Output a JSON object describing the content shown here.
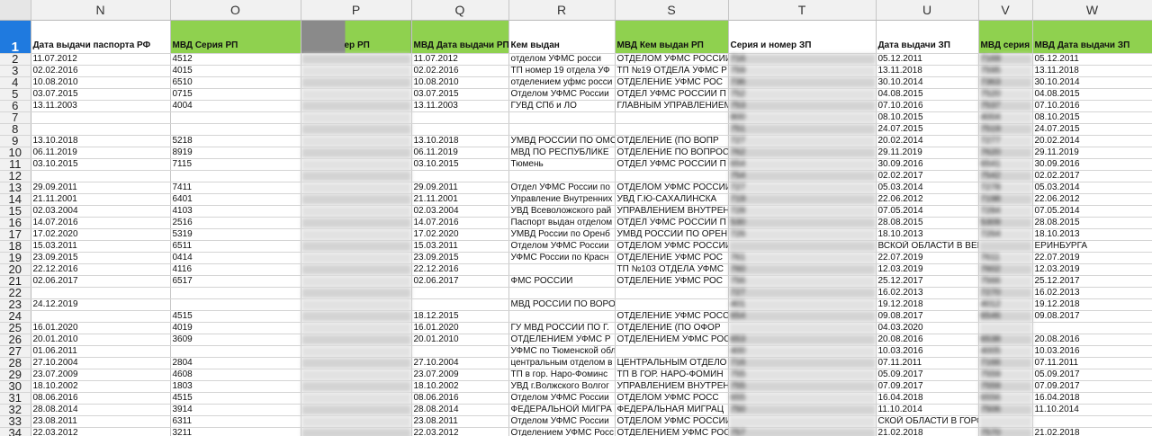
{
  "columns": [
    "N",
    "O",
    "P",
    "Q",
    "R",
    "S",
    "T",
    "U",
    "V",
    "W"
  ],
  "header_row": {
    "num": "1",
    "cells": [
      "Дата выдачи паспорта РФ",
      "МВД Серия РП",
      "ер РП",
      "МВД Дата выдачи РП",
      "Кем выдан",
      "МВД Кем выдан РП",
      "Серия и номер ЗП",
      "Дата выдачи ЗП",
      "МВД серия",
      "МВД Дата выдачи ЗП"
    ]
  },
  "rows": [
    {
      "num": "2",
      "cells": [
        "11.07.2012",
        "4512",
        "",
        "11.07.2012",
        "отделом УФМС росси",
        "ОТДЕЛОМ УФМС РОССИИ",
        "716",
        "05.12.2011",
        "7169",
        "05.12.2011"
      ]
    },
    {
      "num": "3",
      "cells": [
        "02.02.2016",
        "4015",
        "",
        "02.02.2016",
        "ТП номер 19 отдела УФ",
        "ТП №19 ОТДЕЛА УФМС Р",
        "759",
        "13.11.2018",
        "7595",
        "13.11.2018"
      ]
    },
    {
      "num": "4",
      "cells": [
        "10.08.2010",
        "6510",
        "",
        "10.08.2010",
        "отделением уфмс росси",
        "ОТДЕЛЕНИЕ УФМС РОС",
        "736",
        "30.10.2014",
        "7363",
        "30.10.2014"
      ]
    },
    {
      "num": "5",
      "cells": [
        "03.07.2015",
        "0715",
        "",
        "03.07.2015",
        "Отделом УФМС России",
        "ОТДЕЛ УФМС РОССИИ П",
        "752",
        "04.08.2015",
        "7520",
        "04.08.2015"
      ]
    },
    {
      "num": "6",
      "cells": [
        "13.11.2003",
        "4004",
        "",
        "13.11.2003",
        "ГУВД СПб и ЛО",
        "ГЛАВНЫМ УПРАВЛЕНИЕМ",
        "753",
        "07.10.2016",
        "7537",
        "07.10.2016"
      ]
    },
    {
      "num": "7",
      "cells": [
        "",
        "",
        "",
        "",
        "",
        "",
        "800",
        "08.10.2015",
        "4004",
        "08.10.2015"
      ]
    },
    {
      "num": "8",
      "cells": [
        "",
        "",
        "",
        "",
        "",
        "",
        "751",
        "24.07.2015",
        "7519",
        "24.07.2015"
      ]
    },
    {
      "num": "9",
      "cells": [
        "13.10.2018",
        "5218",
        "",
        "13.10.2018",
        "УМВД РОССИИ ПО ОМС",
        "ОТДЕЛЕНИЕ (ПО ВОПР",
        "727",
        "20.02.2014",
        "7277",
        "20.02.2014"
      ]
    },
    {
      "num": "10",
      "cells": [
        "06.11.2019",
        "8919",
        "",
        "06.11.2019",
        "МВД ПО РЕСПУБЛИКЕ",
        "ОТДЕЛЕНИЕ ПО ВОПРОС",
        "762",
        "29.11.2019",
        "7620",
        "29.11.2019"
      ]
    },
    {
      "num": "11",
      "cells": [
        "03.10.2015",
        "7115",
        "",
        "03.10.2015",
        "Тюмень",
        "ОТДЕЛ УФМС РОССИИ П",
        "654",
        "30.09.2016",
        "6541",
        "30.09.2016"
      ]
    },
    {
      "num": "12",
      "cells": [
        "",
        "",
        "",
        "",
        "",
        "",
        "754",
        "02.02.2017",
        "7542",
        "02.02.2017"
      ]
    },
    {
      "num": "13",
      "cells": [
        "29.09.2011",
        "7411",
        "",
        "29.09.2011",
        "Отдел УФМС России по",
        "ОТДЕЛОМ УФМС РОССИИ",
        "727",
        "05.03.2014",
        "7278",
        "05.03.2014"
      ]
    },
    {
      "num": "14",
      "cells": [
        "21.11.2001",
        "6401",
        "",
        "21.11.2001",
        "Управление Внутренних",
        "УВД Г.Ю-САХАЛИНСКА",
        "719",
        "22.06.2012",
        "7198",
        "22.06.2012"
      ]
    },
    {
      "num": "15",
      "cells": [
        "02.03.2004",
        "4103",
        "",
        "02.03.2004",
        "УВД Всеволожского рай",
        "УПРАВЛЕНИЕМ ВНУТРЕН",
        "728",
        "07.05.2014",
        "7284",
        "07.05.2014"
      ]
    },
    {
      "num": "16",
      "cells": [
        "14.07.2016",
        "2516",
        "",
        "14.07.2016",
        "Паспорт выдан отделом",
        "ОТДЕЛ УФМС РОССИИ П",
        "530",
        "28.08.2015",
        "5309",
        "28.08.2015"
      ]
    },
    {
      "num": "17",
      "cells": [
        "17.02.2020",
        "5319",
        "",
        "17.02.2020",
        "УМВД России по Оренб",
        "УМВД РОССИИ ПО ОРЕН",
        "726",
        "18.10.2013",
        "7264",
        "18.10.2013"
      ]
    },
    {
      "num": "18",
      "cells": [
        "15.03.2011",
        "6511",
        "",
        "15.03.2011",
        "Отделом УФМС России",
        "ОТДЕЛОМ УФМС РОССИИ ПО",
        "",
        "ВСКОЙ ОБЛАСТИ В ВЕРХ-ИСЕТСКОМ Р-НЕ ГО",
        "",
        "ЕРИНБУРГА"
      ]
    },
    {
      "num": "19",
      "cells": [
        "23.09.2015",
        "0414",
        "",
        "23.09.2015",
        "УФМС России по Красн",
        "ОТДЕЛЕНИЕ УФМС РОС",
        "761",
        "22.07.2019",
        "7611",
        "22.07.2019"
      ]
    },
    {
      "num": "20",
      "cells": [
        "22.12.2016",
        "4116",
        "",
        "22.12.2016",
        "",
        "ТП №103 ОТДЕЛА УФМС",
        "760",
        "12.03.2019",
        "7602",
        "12.03.2019"
      ]
    },
    {
      "num": "21",
      "cells": [
        "02.06.2017",
        "6517",
        "",
        "02.06.2017",
        "ФМС РОССИИ",
        "ОТДЕЛЕНИЕ УФМС РОС",
        "756",
        "25.12.2017",
        "7566",
        "25.12.2017"
      ]
    },
    {
      "num": "22",
      "cells": [
        "",
        "",
        "",
        "",
        "",
        "",
        "727",
        "16.02.2013",
        "7270",
        "16.02.2013"
      ]
    },
    {
      "num": "23",
      "cells": [
        "24.12.2019",
        "",
        "",
        "",
        "МВД РОССИИ ПО ВОРОНЕЖСКОЙ ОБЛАСТИ",
        "",
        "401",
        "19.12.2018",
        "4012",
        "19.12.2018"
      ]
    },
    {
      "num": "24",
      "cells": [
        "",
        "4515",
        "",
        "18.12.2015",
        "",
        "ОТДЕЛЕНИЕ УФМС РОСС",
        "654",
        "09.08.2017",
        "6546",
        "09.08.2017"
      ]
    },
    {
      "num": "25",
      "cells": [
        "16.01.2020",
        "4019",
        "",
        "16.01.2020",
        "ГУ МВД РОССИИ ПО Г.",
        "ОТДЕЛЕНИЕ (ПО ОФОР",
        "",
        "04.03.2020",
        "",
        ""
      ]
    },
    {
      "num": "26",
      "cells": [
        "20.01.2010",
        "3609",
        "",
        "20.01.2010",
        "ОТДЕЛЕНИЕМ УФМС Р",
        "ОТДЕЛЕНИЕМ УФМС РОС",
        "653",
        "20.08.2016",
        "6538",
        "20.08.2016"
      ]
    },
    {
      "num": "27",
      "cells": [
        "01.06.2011",
        "",
        "",
        "",
        "УФМС по Тюменской области",
        "",
        "400",
        "10.03.2016",
        "4005",
        "10.03.2016"
      ]
    },
    {
      "num": "28",
      "cells": [
        "27.10.2004",
        "2804",
        "",
        "27.10.2004",
        "центральным отделом в",
        "ЦЕНТРАЛЬНЫМ ОТДЕЛО",
        "716",
        "07.11.2011",
        "7166",
        "07.11.2011"
      ]
    },
    {
      "num": "29",
      "cells": [
        "23.07.2009",
        "4608",
        "",
        "23.07.2009",
        "ТП в гор. Наро-Фоминс",
        "ТП В ГОР. НАРО-ФОМИН",
        "755",
        "05.09.2017",
        "7559",
        "05.09.2017"
      ]
    },
    {
      "num": "30",
      "cells": [
        "18.10.2002",
        "1803",
        "",
        "18.10.2002",
        "УВД г.Волжского Волгог",
        "УПРАВЛЕНИЕМ ВНУТРЕН",
        "755",
        "07.09.2017",
        "7559",
        "07.09.2017"
      ]
    },
    {
      "num": "31",
      "cells": [
        "08.06.2016",
        "4515",
        "",
        "08.06.2016",
        "Отделом УФМС России",
        "ОТДЕЛОМ УФМС РОСС",
        "655",
        "16.04.2018",
        "6556",
        "16.04.2018"
      ]
    },
    {
      "num": "32",
      "cells": [
        "28.08.2014",
        "3914",
        "",
        "28.08.2014",
        "ФЕДЕРАЛЬНОЙ МИГРА",
        "ФЕДЕРАЛЬНАЯ МИГРАЦ",
        "750",
        "11.10.2014",
        "7506",
        "11.10.2014"
      ]
    },
    {
      "num": "33",
      "cells": [
        "23.08.2011",
        "6311",
        "",
        "23.08.2011",
        "Отделом УФМС России",
        "ОТДЕЛОМ УФМС РОССИИ ПО",
        "",
        "СКОЙ ОБЛАСТИ В ГОРОДЕ ЭНГЕЛЬСЕ",
        "",
        ""
      ]
    },
    {
      "num": "34",
      "cells": [
        "22.03.2012",
        "3211",
        "",
        "22.03.2012",
        "Отделением УФМС Росс",
        "ОТДЕЛЕНИЕМ УФМС РОС",
        "757",
        "21.02.2018",
        "7570",
        "21.02.2018"
      ]
    },
    {
      "num": "35",
      "cells": [
        "21.06.2016",
        "0416",
        "",
        "21.06.2016",
        "отделом УФМС России",
        "ОТДЕЛ УФМС РОССИИ П",
        "761",
        "25.10.2019",
        "7618",
        "25.10.2019"
      ]
    }
  ]
}
